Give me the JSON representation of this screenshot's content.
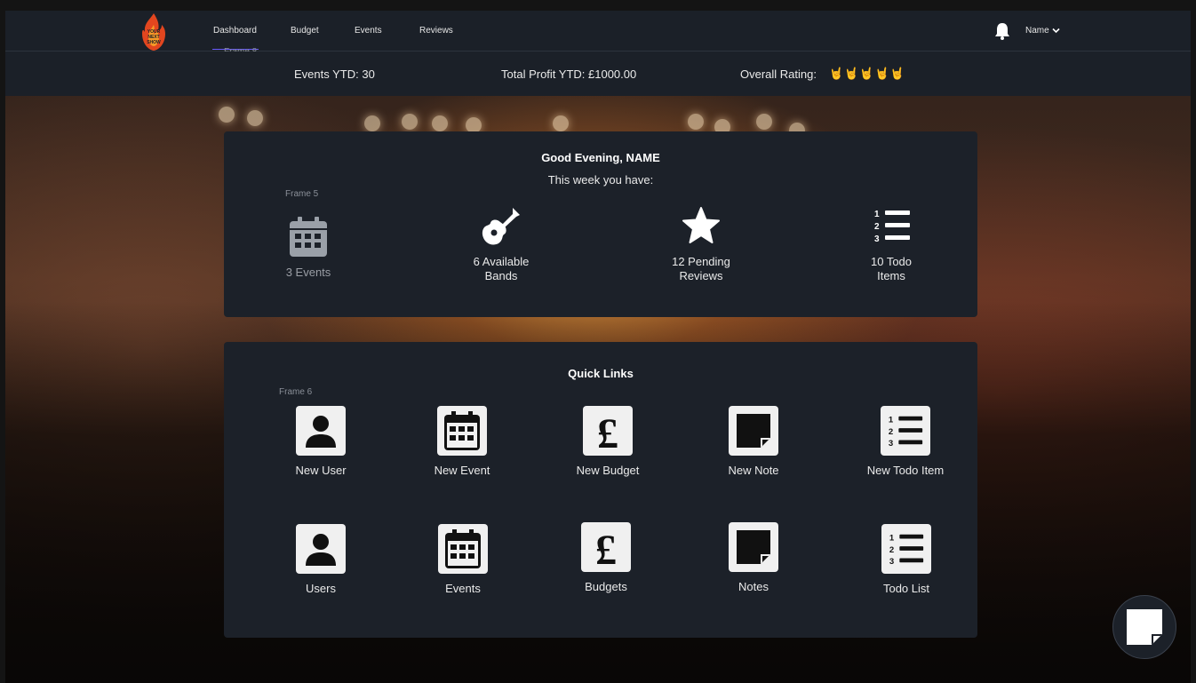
{
  "nav": {
    "logo_text": "YOUR NEXT SHOW",
    "items": [
      {
        "label": "Dashboard"
      },
      {
        "label": "Budget"
      },
      {
        "label": "Events"
      },
      {
        "label": "Reviews"
      }
    ],
    "frame_label": "Frame 8",
    "user_name": "Name",
    "user_chevron": "⌄"
  },
  "stats": {
    "events_ytd": "Events YTD: 30",
    "profit_ytd": "Total Profit YTD: £1000.00",
    "overall_rating_label": "Overall Rating:",
    "rating_icons": "🤘🤘🤘🤘🤘"
  },
  "summary": {
    "greeting": "Good Evening, NAME",
    "subtitle": "This week you have:",
    "frame_label": "Frame 5",
    "items": [
      {
        "line1": "3 Events",
        "line2": "",
        "icon": "calendar-icon"
      },
      {
        "line1": "6 Available",
        "line2": "Bands",
        "icon": "guitar-icon"
      },
      {
        "line1": "12 Pending",
        "line2": "Reviews",
        "icon": "star-icon"
      },
      {
        "line1": "10 Todo",
        "line2": "Items",
        "icon": "numbered-list-icon"
      }
    ]
  },
  "quick_links": {
    "title": "Quick Links",
    "frame_label": "Frame 6",
    "row1": [
      {
        "label": "New User",
        "icon": "user-icon"
      },
      {
        "label": "New Event",
        "icon": "calendar-icon"
      },
      {
        "label": "New Budget",
        "icon": "pound-icon"
      },
      {
        "label": "New Note",
        "icon": "note-icon"
      },
      {
        "label": "New Todo Item",
        "icon": "numbered-list-icon"
      }
    ],
    "row2": [
      {
        "label": "Users",
        "icon": "user-icon"
      },
      {
        "label": "Events",
        "icon": "calendar-icon"
      },
      {
        "label": "Budgets",
        "icon": "pound-icon"
      },
      {
        "label": "Notes",
        "icon": "note-icon"
      },
      {
        "label": "Todo List",
        "icon": "numbered-list-icon"
      }
    ]
  },
  "colors": {
    "panel": "#1c2129",
    "nav_bg": "#1b2028",
    "active_underline": "#6a5cff",
    "logo_flame": "#e2461f"
  }
}
